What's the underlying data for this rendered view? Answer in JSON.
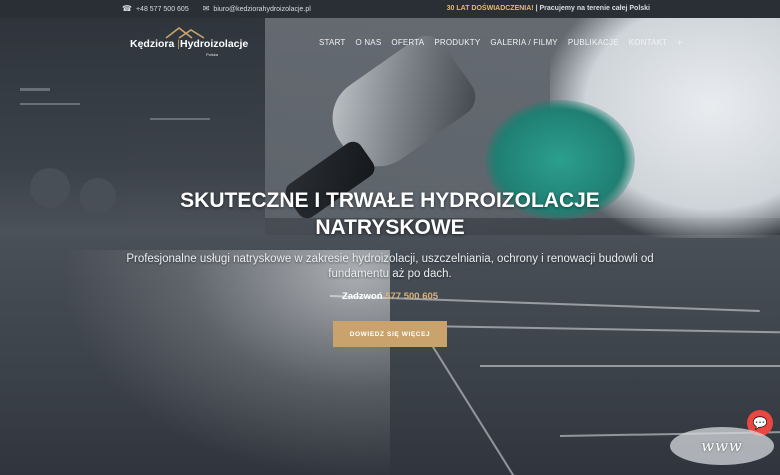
{
  "topbar": {
    "phone": "+48 577 500 605",
    "email": "biuro@kedziorahydroizolacje.pl",
    "promo_accent": "30 LAT DOŚWIADCZENIA!",
    "promo_rest": " | Pracujemy na terenie całej Polski"
  },
  "logo": {
    "name_left": "Kędziora",
    "separator": "|",
    "name_right": "Hydroizolacje",
    "subtitle": "Polska"
  },
  "nav": {
    "items": [
      "START",
      "O NAS",
      "OFERTA",
      "PRODUKTY",
      "GALERIA / FILMY",
      "PUBLIKACJE",
      "KONTAKT",
      "+"
    ]
  },
  "hero": {
    "headline_line1": "SKUTECZNE I TRWAŁE HYDROIZOLACJE",
    "headline_line2": "NATRYSKOWE",
    "subline": "Profesjonalne usługi natryskowe w zakresie hydroizolacji, uszczelniania, ochrony i renowacji budowli od fundamentu aż po dach.",
    "call_label": "Zadzwoń",
    "call_number": "577 500 605",
    "cta_label": "DOWIEDZ SIĘ WIĘCEJ"
  },
  "overlay": {
    "www_label": "www"
  },
  "colors": {
    "accent": "#c9a36b",
    "chat": "#e9473f",
    "topbar": "#2a2f36"
  },
  "icons": {
    "phone": "phone-icon",
    "email": "envelope-icon",
    "chat": "chat-icon"
  }
}
